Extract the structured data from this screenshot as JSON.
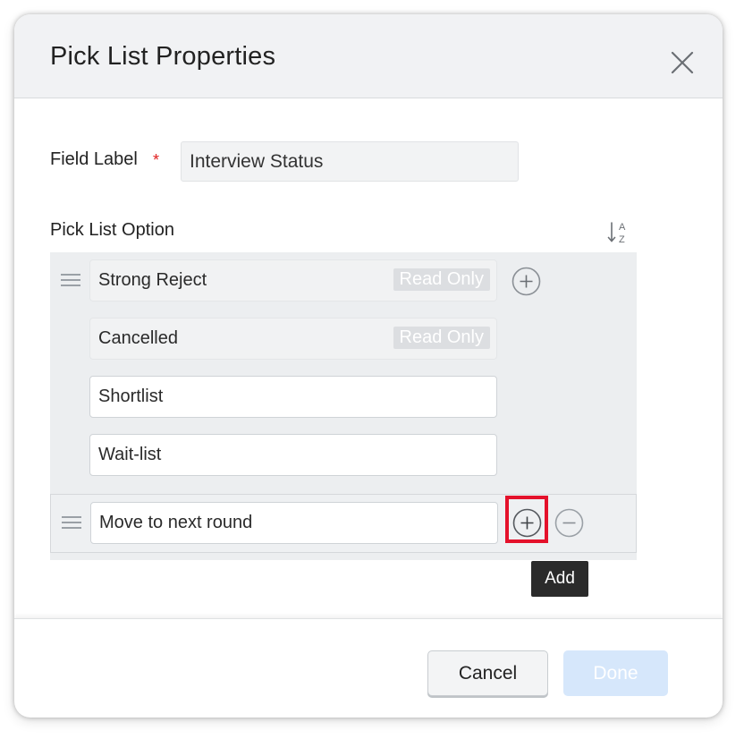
{
  "dialog": {
    "title": "Pick List Properties",
    "close_icon": "close-icon"
  },
  "field": {
    "label": "Field Label",
    "required_marker": "*",
    "value": "Interview Status"
  },
  "picklist": {
    "label": "Pick List Option",
    "sort_icon": "sort-az-icon",
    "sort_letters": [
      "A",
      "Z"
    ],
    "options": [
      {
        "value": "Strong Reject",
        "badge": "Read Only",
        "readonly": true
      },
      {
        "value": "Cancelled",
        "badge": "Read Only",
        "readonly": true
      },
      {
        "value": "Shortlist",
        "readonly": false
      },
      {
        "value": "Wait-list",
        "readonly": false
      },
      {
        "value": "Move to next round",
        "readonly": false
      }
    ]
  },
  "tooltip": {
    "text": "Add"
  },
  "footer": {
    "cancel_label": "Cancel",
    "done_label": "Done"
  },
  "colors": {
    "highlight": "#e4112b",
    "required": "#e02020",
    "done_button_disabled": "#d6e7fb",
    "tooltip_bg": "#2b2b2b"
  }
}
